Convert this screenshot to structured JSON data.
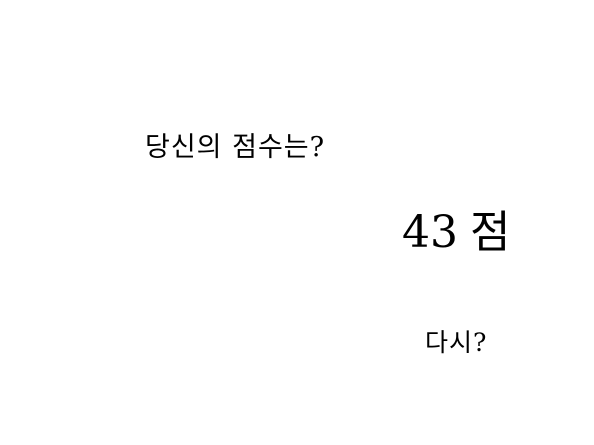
{
  "result": {
    "question": "당신의 점수는?",
    "score": "43",
    "score_unit": "점",
    "retry_label": "다시?"
  }
}
